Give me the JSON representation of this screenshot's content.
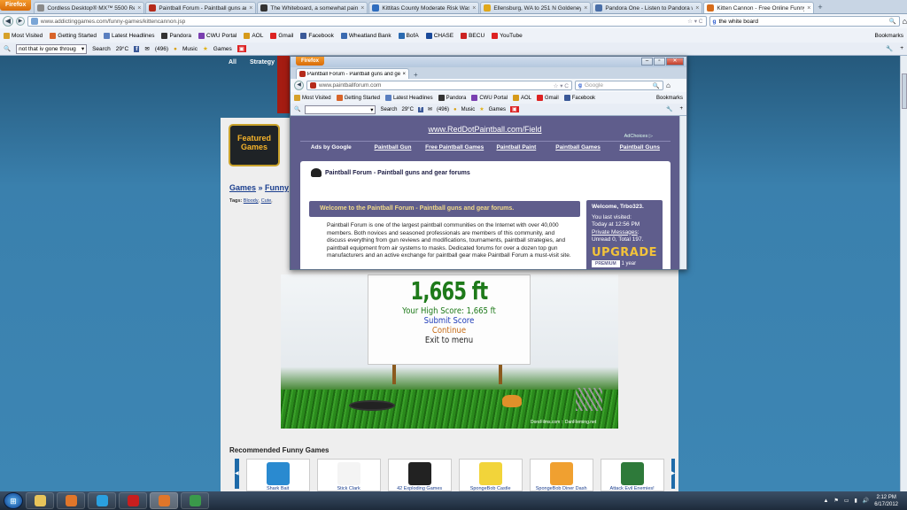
{
  "main_browser": {
    "menu_button": "Firefox",
    "tabs": [
      {
        "title": "Cordless Desktop® MX™ 5500 Rev...",
        "color": "#8a8a8a"
      },
      {
        "title": "Paintball Forum - Paintball guns an...",
        "color": "#b52a1a"
      },
      {
        "title": "The Whiteboard, a somewhat paint...",
        "color": "#333333"
      },
      {
        "title": "Kittitas County Moderate Risk Wast...",
        "color": "#2f6dbf"
      },
      {
        "title": "Ellensburg, WA to 251 N Goldeneye...",
        "color": "#e0a81b"
      },
      {
        "title": "Pandora One - Listen to Pandora w...",
        "color": "#4a6fa8"
      },
      {
        "title": "Kitten Cannon - Free Online Funny ...",
        "color": "#d66b1a"
      }
    ],
    "url": "www.addictinggames.com/funny-games/kittencannon.jsp",
    "search_value": "the white board",
    "bookmarks_label": "Bookmarks",
    "bookmarks": [
      "Most Visited",
      "Getting Started",
      "Latest Headlines",
      "Pandora",
      "CWU Portal",
      "AOL",
      "Gmail",
      "Facebook",
      "Wheatland Bank",
      "BofA",
      "CHASE",
      "BECU",
      "YouTube"
    ],
    "toolbar": {
      "select_value": "not that iv gone throug",
      "search_label": "Search",
      "temperature": "29°C",
      "mail_count": "(496)",
      "music_label": "Music",
      "games_label": "Games"
    }
  },
  "site": {
    "nav_items": [
      "All",
      "Strategy"
    ],
    "featured_label": "Featured Games",
    "breadcrumb_games": "Games",
    "breadcrumb_sep": " » ",
    "breadcrumb_funny": "Funny",
    "tags_label": "Tags:",
    "tags": [
      "Bloody",
      ", ",
      "Cute",
      ", "
    ],
    "game": {
      "distance": "1,665 ft",
      "high_score": "Your High Score: 1,665 ft",
      "submit": "Submit Score",
      "continue": "Continue",
      "exit": "Exit to menu",
      "footer": "DorsFilms.com :: DanFleming.net"
    },
    "recommended_title": "Recommended Funny Games",
    "recommended": [
      {
        "label": "Shark Bait",
        "color": "#2a8ad0"
      },
      {
        "label": "Stick Clark",
        "color": "#f4f4f4"
      },
      {
        "label": "42 Exploding Games",
        "color": "#222222"
      },
      {
        "label": "SpongeBob Castle",
        "color": "#f2d43a"
      },
      {
        "label": "SpongeBob Diner Dash",
        "color": "#f0a030"
      },
      {
        "label": "Attack Evil Enemies!",
        "color": "#2e7a3a"
      }
    ]
  },
  "popup": {
    "menu_button": "Firefox",
    "tab_title": "Paintball Forum - Paintball guns and ge...",
    "url": "www.paintballforum.com",
    "search_placeholder": "Google",
    "bookmarks_label": "Bookmarks",
    "bookmarks": [
      "Most Visited",
      "Getting Started",
      "Latest Headlines",
      "Pandora",
      "CWU Portal",
      "AOL",
      "Gmail",
      "Facebook"
    ],
    "toolbar": {
      "search_label": "Search",
      "temperature": "29°C",
      "mail_count": "(496)",
      "music_label": "Music",
      "games_label": "Games"
    },
    "ad_url": "www.RedDotPaintball.com/Field",
    "ad_choices": "AdChoices ▷",
    "ad_links": [
      "Ads by Google",
      "Paintball Gun",
      "Free Paintball Games",
      "Paintball Paint",
      "Paintball Games",
      "Paintball Guns"
    ],
    "forum_title": "Paintball Forum - Paintball guns and gear forums",
    "welcome_heading": "Welcome to the Paintball Forum - Paintball guns and gear forums.",
    "description": "Paintball Forum is one of the largest paintball communities on the Internet with over 40,000 members. Both novices and seasoned professionals are members of this community, and discuss everything from gun reviews and modifications, tournaments, paintball strategies, and paintball equipment from air systems to masks. Dedicated forums for over a dozen top gun manufacturers and an active exchange for paintball gear make Paintball Forum a must-visit site.",
    "sidebar": {
      "welcome": "Welcome, Trbo323.",
      "last_visited_label": "You last visited:",
      "last_visited": "Today at 12:56 PM",
      "pm_link": "Private Messages",
      "pm_status": "Unread 0, Total 197.",
      "upgrade": "UPGRADE",
      "premium": "PREMIUM",
      "duration": "1 year"
    }
  },
  "taskbar": {
    "apps": [
      {
        "name": "explorer",
        "color": "#e8c45a"
      },
      {
        "name": "firefox",
        "color": "#e0762a"
      },
      {
        "name": "skype",
        "color": "#2aa0e0"
      },
      {
        "name": "acrobat",
        "color": "#c81e1e"
      },
      {
        "name": "firefox-active",
        "color": "#e0762a"
      },
      {
        "name": "app",
        "color": "#3a9a4a"
      }
    ],
    "time": "2:12 PM",
    "date": "6/17/2012"
  }
}
